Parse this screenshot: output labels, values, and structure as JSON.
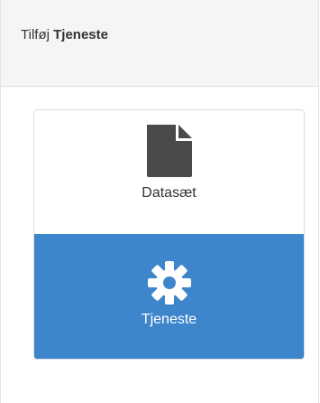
{
  "header": {
    "title_prefix": "Tilføj",
    "title_strong": "Tjeneste"
  },
  "options": {
    "dataset": {
      "label": "Datasæt",
      "icon": "file-icon",
      "selected": false
    },
    "service": {
      "label": "Tjeneste",
      "icon": "gear-icon",
      "selected": true
    }
  },
  "colors": {
    "selected_background": "#3d86cb",
    "header_background": "#f5f5f5",
    "icon_dark": "#4a4a4a",
    "text_dark": "#333333",
    "text_light": "#ffffff"
  }
}
